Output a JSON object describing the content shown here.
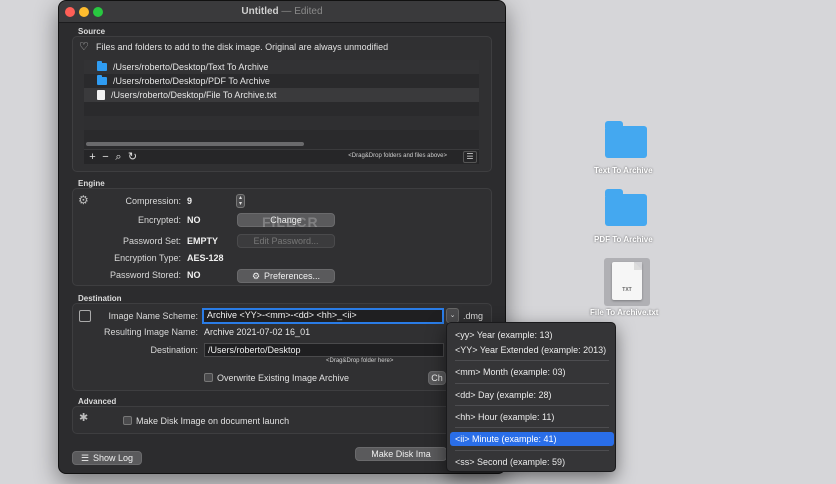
{
  "window": {
    "title": "Untitled",
    "separator": "—",
    "edited": "Edited"
  },
  "source": {
    "section_label": "Source",
    "description": "Files and folders to add to the disk image. Original are always unmodified",
    "files": [
      {
        "path": "/Users/roberto/Desktop/Text To Archive",
        "icon": "folder-icon"
      },
      {
        "path": "/Users/roberto/Desktop/PDF To Archive",
        "icon": "folder-icon"
      },
      {
        "path": "/Users/roberto/Desktop/File To Archive.txt",
        "icon": "text-file-icon"
      }
    ],
    "toolbar": {
      "add": "+",
      "remove": "−",
      "search": "⌕",
      "refresh": "↻",
      "hint": "<Drag&Drop folders and files above>",
      "menu": "☰"
    }
  },
  "engine": {
    "section_label": "Engine",
    "compression_label": "Compression:",
    "compression_value": "9",
    "encrypted_label": "Encrypted:",
    "encrypted_value": "NO",
    "change_button": "Change",
    "password_set_label": "Password Set:",
    "password_set_value": "EMPTY",
    "edit_password_button": "Edit Password...",
    "encryption_type_label": "Encryption Type:",
    "encryption_type_value": "AES-128",
    "password_stored_label": "Password  Stored:",
    "password_stored_value": "NO",
    "preferences_button": "Preferences..."
  },
  "destination": {
    "section_label": "Destination",
    "scheme_label": "Image Name Scheme:",
    "scheme_value": "Archive <YY>-<mm>-<dd> <hh>_<ii>",
    "extension": ".dmg",
    "resulting_label": "Resulting Image Name:",
    "resulting_value": "Archive 2021-07-02 16_01",
    "destination_label": "Destination:",
    "destination_value": "/Users/roberto/Desktop",
    "destination_hint": "<Drag&Drop folder here>",
    "overwrite_label": "Overwrite Existing Image Archive",
    "choose_button": "Ch"
  },
  "advanced": {
    "section_label": "Advanced",
    "launch_label": "Make Disk Image on document launch"
  },
  "footer": {
    "show_log": "Show Log",
    "make_button": "Make Disk Ima"
  },
  "menu": {
    "items": [
      "<yy> Year (example: 13)",
      "<YY> Year Extended (example: 2013)",
      "<mm> Month (example: 03)",
      "<dd> Day (example: 28)",
      "<hh> Hour (example: 11)",
      "<ii> Minute (example: 41)",
      "<ss> Second (example: 59)"
    ],
    "selected_index": 5
  },
  "desktop": {
    "items": [
      {
        "label": "Text To Archive",
        "icon": "folder-icon"
      },
      {
        "label": "PDF To Archive",
        "icon": "folder-icon"
      },
      {
        "label": "File To Archive.txt",
        "icon": "text-file-icon",
        "badge": "TXT"
      }
    ]
  },
  "watermark": "FILECR",
  "colors": {
    "accent": "#2a6ee8",
    "folder": "#44a8f0",
    "window_bg": "#2c2c2e",
    "desktop_bg": "#d6d6d9"
  }
}
